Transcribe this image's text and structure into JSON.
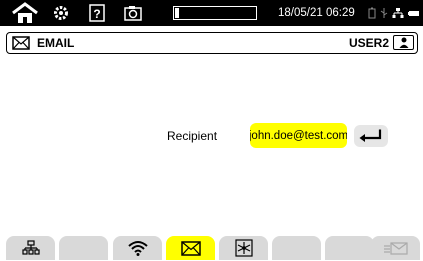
{
  "status_bar": {
    "datetime": "18/05/21 06:29",
    "memory_fill_fraction": 0.05,
    "icons": [
      "home-icon",
      "settings-icon",
      "help-icon",
      "camera-icon",
      "battery-icon",
      "usb-icon",
      "network-icon",
      "power-icon"
    ]
  },
  "title_bar": {
    "icon": "email-icon",
    "title": "EMAIL",
    "user": "USER2"
  },
  "form": {
    "recipient_label": "Recipient",
    "recipient_value": "john.doe@test.com"
  },
  "tabs": [
    {
      "icon": "network-icon",
      "active": false
    },
    {
      "icon": "",
      "active": false
    },
    {
      "icon": "wifi-icon",
      "active": false
    },
    {
      "icon": "email-icon",
      "active": true
    },
    {
      "icon": "star-network-icon",
      "active": false
    },
    {
      "icon": "",
      "active": false
    },
    {
      "icon": "",
      "active": false
    },
    {
      "icon": "send-email-icon",
      "active": false
    }
  ],
  "colors": {
    "active": "#ffff00",
    "tab": "#d9d9d9",
    "statusbar": "#000000"
  }
}
